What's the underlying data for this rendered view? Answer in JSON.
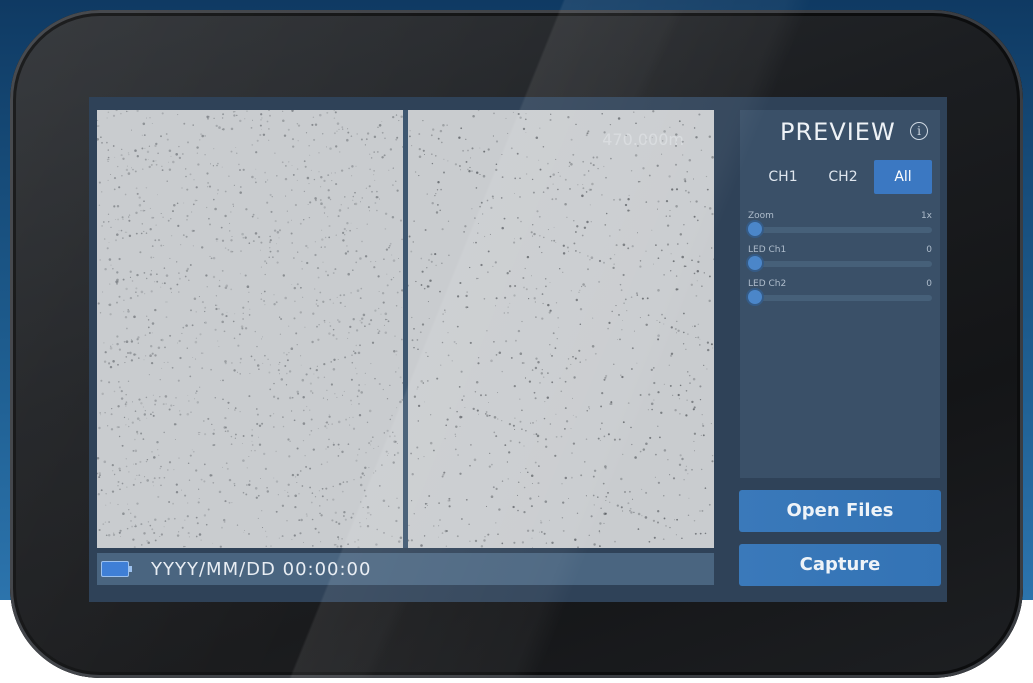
{
  "preview": {
    "title": "PREVIEW",
    "scale_label": "470.000m"
  },
  "tabs": [
    {
      "label": "CH1",
      "active": false
    },
    {
      "label": "CH2",
      "active": false
    },
    {
      "label": "All",
      "active": true
    }
  ],
  "sliders": [
    {
      "label": "Zoom",
      "value": "1x"
    },
    {
      "label": "LED Ch1",
      "value": "0"
    },
    {
      "label": "LED Ch2",
      "value": "0"
    }
  ],
  "buttons": {
    "open_files": "Open Files",
    "capture": "Capture"
  },
  "status": {
    "datetime": "YYYY/MM/DD  00:00:00"
  },
  "icons": {
    "info": "info-icon",
    "battery": "battery-icon"
  },
  "colors": {
    "accent": "#3b78c2",
    "panel": "#3a5068",
    "screen": "#2f4258"
  }
}
